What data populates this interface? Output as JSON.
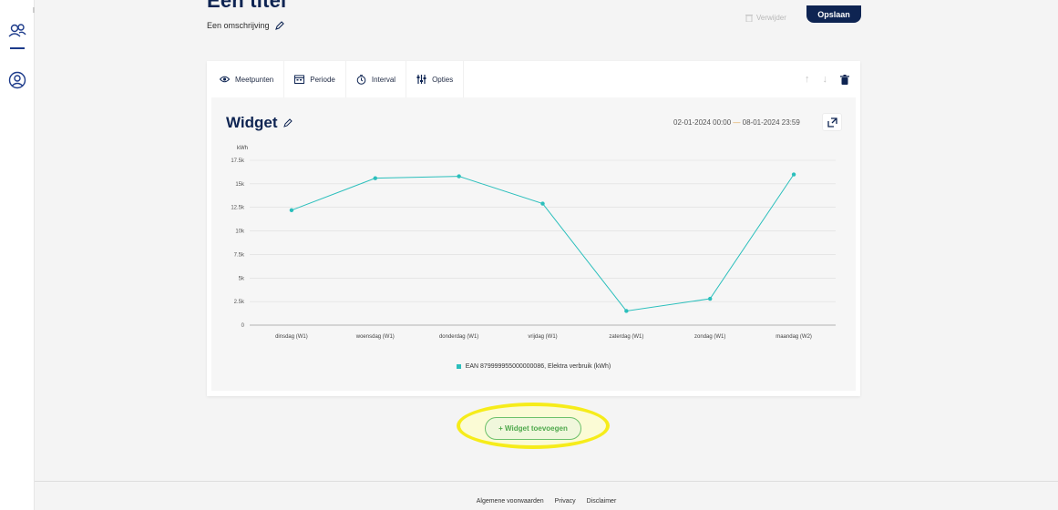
{
  "header": {
    "title": "Een titel",
    "description": "Een omschrijving",
    "delete_label": "Verwijder",
    "save_label": "Opslaan"
  },
  "toolbar": {
    "items": [
      {
        "label": "Meetpunten",
        "icon": "eye-icon"
      },
      {
        "label": "Periode",
        "icon": "calendar-icon"
      },
      {
        "label": "Interval",
        "icon": "timer-icon"
      },
      {
        "label": "Opties",
        "icon": "sliders-icon"
      }
    ],
    "actions": [
      "arrow-up-icon",
      "arrow-down-icon",
      "trash-icon"
    ]
  },
  "widget": {
    "title": "Widget",
    "date_from": "02-01-2024 00:00",
    "date_sep": "—",
    "date_to": "08-01-2024 23:59"
  },
  "chart_data": {
    "type": "line",
    "ylabel": "kWh",
    "ylim": [
      0,
      17500
    ],
    "yticks": [
      "0",
      "2.5k",
      "5k",
      "7.5k",
      "10k",
      "12.5k",
      "15k",
      "17.5k"
    ],
    "categories": [
      "dinsdag (W1)",
      "woensdag (W1)",
      "donderdag (W1)",
      "vrijdag (W1)",
      "zaterdag (W1)",
      "zondag (W1)",
      "maandag (W2)"
    ],
    "series": [
      {
        "name": "EAN 879999955000000086, Elektra verbruik (kWh)",
        "values": [
          12200,
          15600,
          15800,
          12900,
          1500,
          2800,
          16000
        ],
        "color": "#2bbfbc"
      }
    ],
    "grid": true,
    "legend": "bottom"
  },
  "add_widget_label": "+ Widget toevoegen",
  "footer": {
    "links": [
      "Algemene voorwaarden",
      "Privacy",
      "Disclaimer"
    ]
  },
  "colors": {
    "brand": "#0e2452",
    "accent": "#2bbfbc",
    "highlight": "#f6ec1a",
    "add_button": "#4fa94d"
  }
}
